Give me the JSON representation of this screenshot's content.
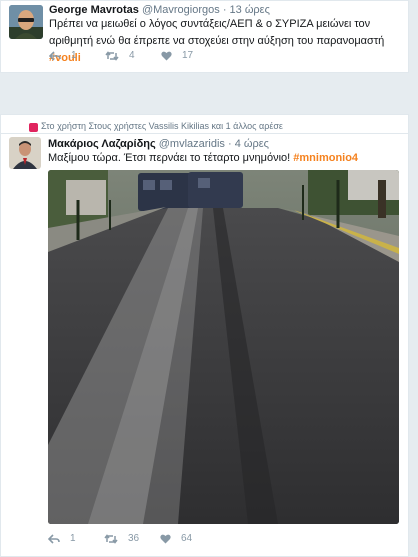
{
  "tweet1": {
    "name": "George Mavrotas",
    "handle": "@Mavrogiorgos",
    "time": "13 ώρες",
    "text": "Πρέπει να μειωθεί ο λόγος συντάξεις/ΑΕΠ & ο ΣΥΡΙΖΑ μειώνει τον αριθμητή ενώ θα έπρεπε να στοχεύει στην αύξηση του παρανομαστή",
    "hashtag": "#vouli",
    "reply_count": "1",
    "retweet_count": "4",
    "like_count": "17"
  },
  "tweet2": {
    "context": "Στο χρήστη Στους χρήστες Vassilis Kikilias και 1 άλλος αρέσε",
    "name": "Μακάριος Λαζαρίδης",
    "handle": "@mvlazaridis",
    "time": "4 ώρες",
    "text": "Μαξίμου τώρα. Έτσι περνάει το τέταρτο μνημόνιο!",
    "hashtag": "#mnimonio4",
    "reply_count": "1",
    "retweet_count": "36",
    "like_count": "64"
  },
  "icons": [
    "reply-icon",
    "retweet-icon",
    "like-icon",
    "heart-icon"
  ],
  "colors": {
    "hashtag": "#f5821f",
    "muted": "#8899a6",
    "like": "#e0245e"
  }
}
